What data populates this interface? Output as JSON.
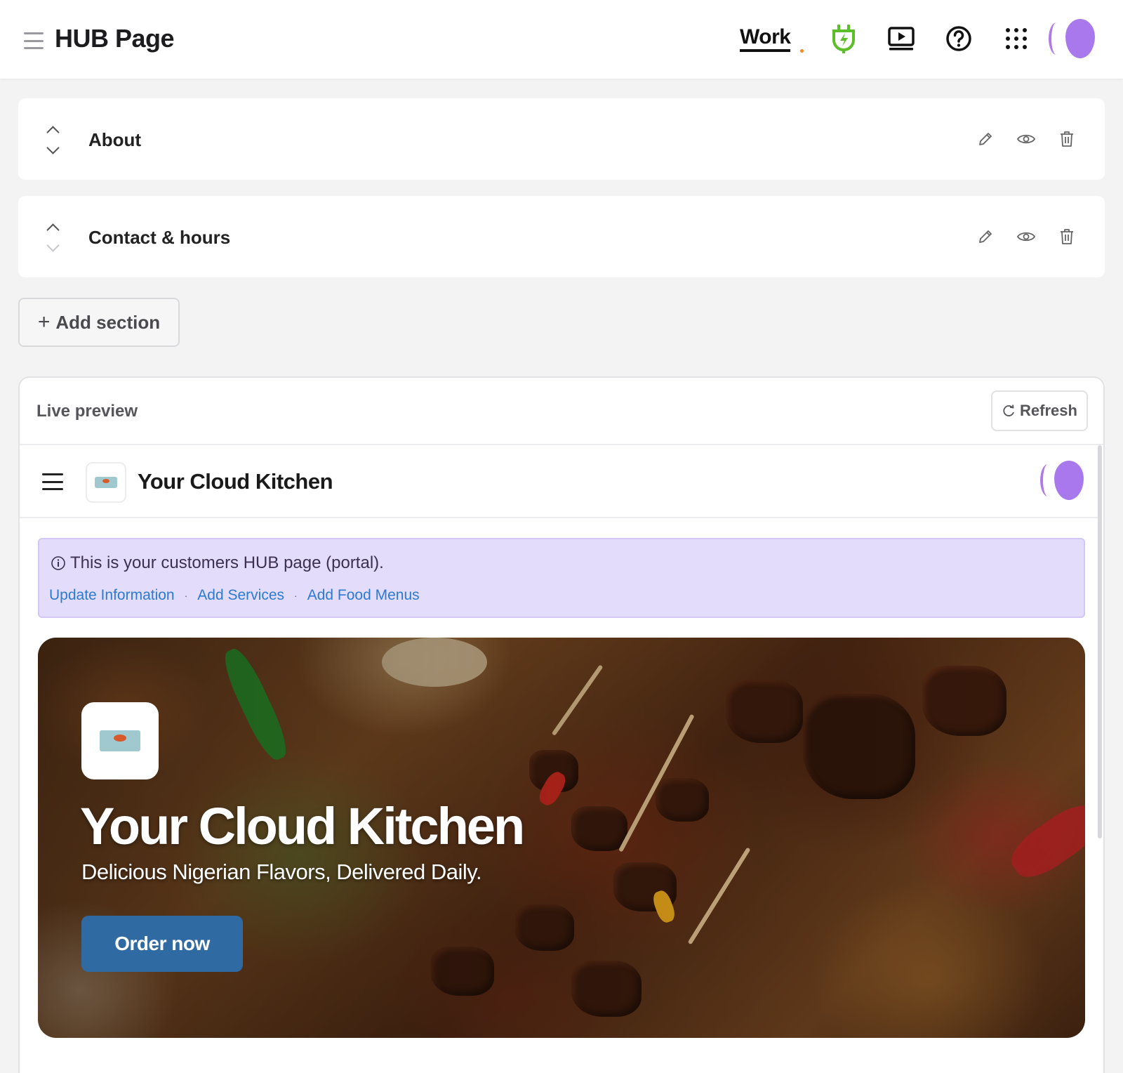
{
  "header": {
    "title": "HUB Page",
    "work_label": "Work",
    "colors": {
      "plug_icon": "#5cbf2a",
      "avatar": "#a978ec",
      "work_dot": "#f08a24"
    }
  },
  "sections": [
    {
      "title": "About",
      "icons": [
        "chevron-up-icon",
        "chevron-down-icon",
        "pencil-icon",
        "eye-icon",
        "trash-icon"
      ]
    },
    {
      "title": "Contact & hours",
      "icons": [
        "chevron-up-icon",
        "chevron-down-icon",
        "pencil-icon",
        "eye-icon",
        "trash-icon"
      ]
    }
  ],
  "add_section_label": "Add section",
  "preview": {
    "label": "Live preview",
    "refresh_label": "Refresh",
    "site": {
      "name": "Your Cloud Kitchen",
      "notice": "This is your customers HUB page (portal).",
      "links": [
        "Update Information",
        "Add Services",
        "Add Food Menus"
      ],
      "hero": {
        "title": "Your Cloud Kitchen",
        "subtitle": "Delicious Nigerian Flavors, Delivered Daily.",
        "cta_label": "Order now"
      }
    }
  },
  "colors": {
    "notice_bg": "#e4dcfb",
    "link": "#2b7bd3",
    "cta_bg": "#2f6aa3"
  }
}
